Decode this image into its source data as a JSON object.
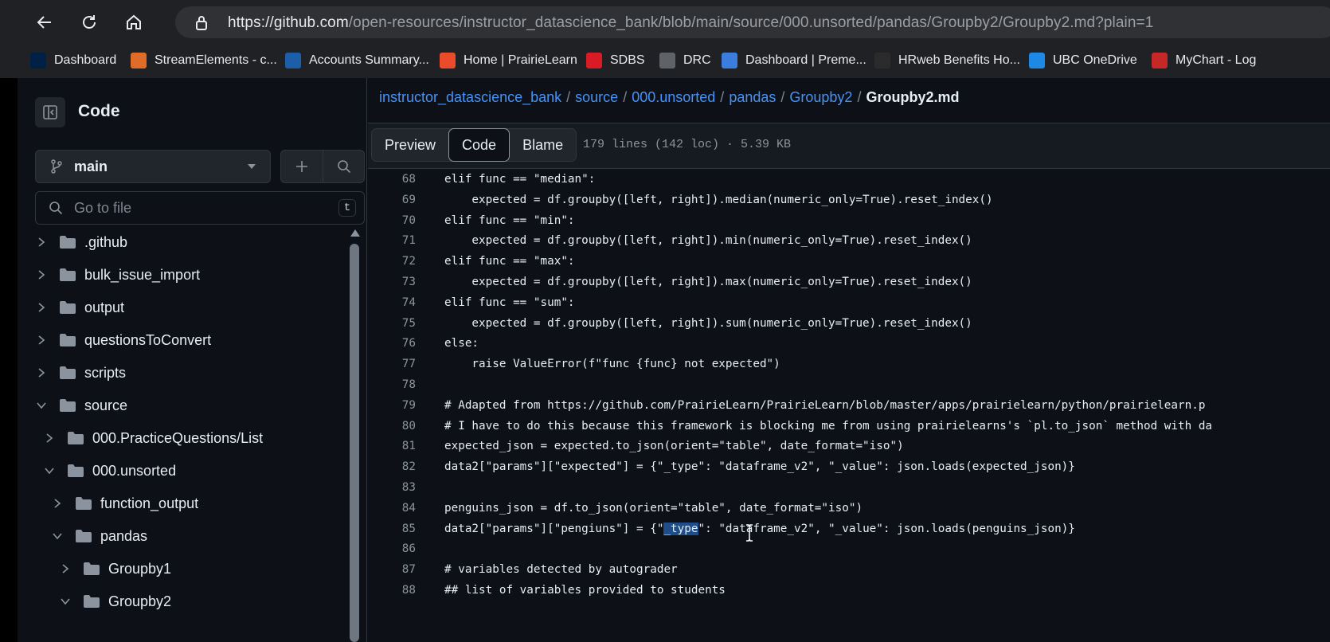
{
  "browser": {
    "url_host": "https://github.com",
    "url_path": "/open-resources/instructor_datascience_bank/blob/main/source/000.unsorted/pandas/Groupby2/Groupby2.md?plain=1",
    "bookmarks": [
      {
        "label": "Dashboard",
        "color": "#002145"
      },
      {
        "label": "StreamElements - c...",
        "color": "#e06c2a"
      },
      {
        "label": "Accounts Summary...",
        "color": "#1c5fa8"
      },
      {
        "label": "Home | PrairieLearn",
        "color": "#e94b2b"
      },
      {
        "label": "SDBS",
        "color": "#d81b25"
      },
      {
        "label": "DRC",
        "color": "#5f6368"
      },
      {
        "label": "Dashboard | Preme...",
        "color": "#3b7ddd"
      },
      {
        "label": "HRweb Benefits Ho...",
        "color": "#2b2b2b"
      },
      {
        "label": "UBC OneDrive",
        "color": "#1e88e5"
      },
      {
        "label": "MyChart - Log",
        "color": "#c62828"
      }
    ]
  },
  "sidebar": {
    "title": "Code",
    "branch": "main",
    "goto_placeholder": "Go to file",
    "goto_shortcut": "t",
    "tree": [
      {
        "label": ".github",
        "expanded": false
      },
      {
        "label": "bulk_issue_import",
        "expanded": false
      },
      {
        "label": "output",
        "expanded": false
      },
      {
        "label": "questionsToConvert",
        "expanded": false
      },
      {
        "label": "scripts",
        "expanded": false
      },
      {
        "label": "source",
        "expanded": true
      },
      {
        "label": "000.PracticeQuestions/List",
        "expanded": false
      },
      {
        "label": "000.unsorted",
        "expanded": true
      },
      {
        "label": "function_output",
        "expanded": false
      },
      {
        "label": "pandas",
        "expanded": true
      },
      {
        "label": "Groupby1",
        "expanded": false
      },
      {
        "label": "Groupby2",
        "expanded": true
      }
    ]
  },
  "main": {
    "breadcrumb": [
      "instructor_datascience_bank",
      "source",
      "000.unsorted",
      "pandas",
      "Groupby2"
    ],
    "current_file": "Groupby2.md",
    "tabs": [
      "Preview",
      "Code",
      "Blame"
    ],
    "active_tab": "Code",
    "meta": "179 lines (142 loc) · 5.39 KB",
    "lines": [
      {
        "n": "68",
        "text": "elif func == \"median\":"
      },
      {
        "n": "69",
        "text": "    expected = df.groupby([left, right]).median(numeric_only=True).reset_index()"
      },
      {
        "n": "70",
        "text": "elif func == \"min\":"
      },
      {
        "n": "71",
        "text": "    expected = df.groupby([left, right]).min(numeric_only=True).reset_index()"
      },
      {
        "n": "72",
        "text": "elif func == \"max\":"
      },
      {
        "n": "73",
        "text": "    expected = df.groupby([left, right]).max(numeric_only=True).reset_index()"
      },
      {
        "n": "74",
        "text": "elif func == \"sum\":"
      },
      {
        "n": "75",
        "text": "    expected = df.groupby([left, right]).sum(numeric_only=True).reset_index()"
      },
      {
        "n": "76",
        "text": "else:"
      },
      {
        "n": "77",
        "text": "    raise ValueError(f\"func {func} not expected\")"
      },
      {
        "n": "78",
        "text": ""
      },
      {
        "n": "79",
        "text": "# Adapted from https://github.com/PrairieLearn/PrairieLearn/blob/master/apps/prairielearn/python/prairielearn.p"
      },
      {
        "n": "80",
        "text": "# I have to do this because this framework is blocking me from using prairielearns's `pl.to_json` method with da"
      },
      {
        "n": "81",
        "text": "expected_json = expected.to_json(orient=\"table\", date_format=\"iso\")"
      },
      {
        "n": "82",
        "text": "data2[\"params\"][\"expected\"] = {\"_type\": \"dataframe_v2\", \"_value\": json.loads(expected_json)}"
      },
      {
        "n": "83",
        "text": ""
      },
      {
        "n": "84",
        "text": "penguins_json = df.to_json(orient=\"table\", date_format=\"iso\")"
      },
      {
        "n": "85",
        "text": "data2[\"params\"][\"pengiuns\"] = {\"_type\": \"dataframe_v2\", \"_value\": json.loads(penguins_json)}"
      },
      {
        "n": "86",
        "text": ""
      },
      {
        "n": "87",
        "text": "# variables detected by autograder"
      },
      {
        "n": "88",
        "text": "## list of variables provided to students"
      }
    ],
    "selected_line": "85",
    "selected_text": "_type"
  }
}
